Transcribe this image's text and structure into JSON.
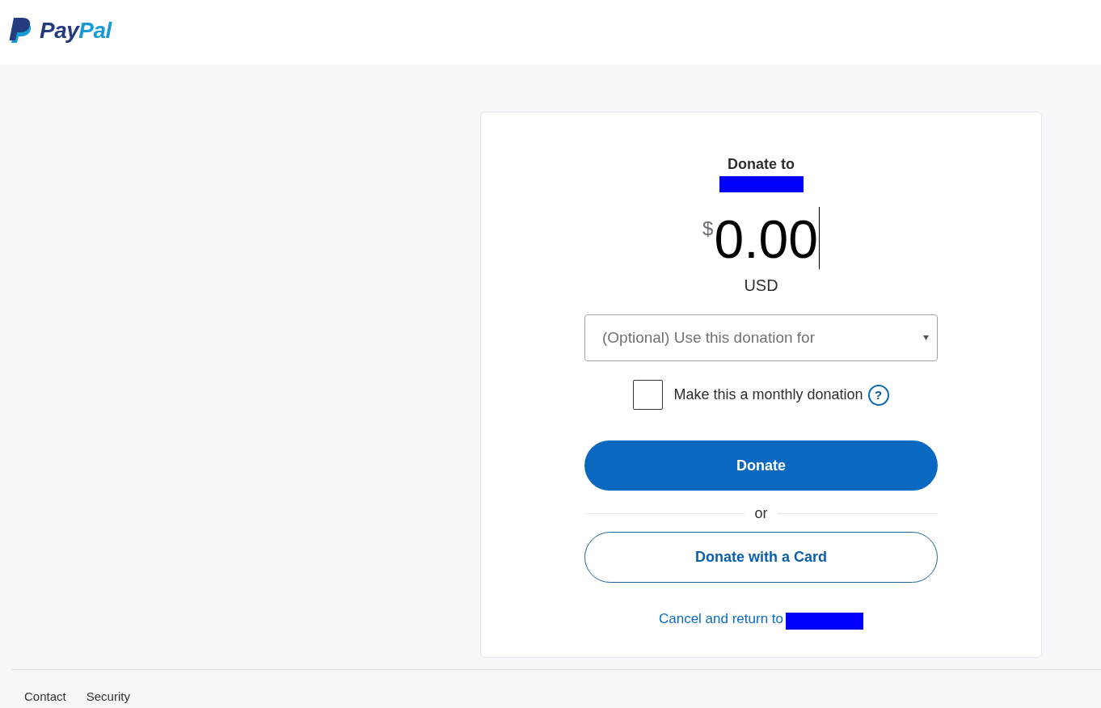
{
  "header": {
    "logo": {
      "wordmark": [
        "Pay",
        "Pal"
      ]
    }
  },
  "donation_form": {
    "heading": "Donate to",
    "amount": {
      "currency_symbol": "$",
      "value": "0.00",
      "currency": "USD",
      "focused": true
    },
    "purpose_dropdown": {
      "placeholder": "(Optional) Use this donation for"
    },
    "monthly": {
      "label": "Make this a monthly donation",
      "checked": false,
      "help": "?"
    },
    "donate_button": "Donate",
    "divider": "or",
    "card_button": "Donate with a Card",
    "cancel_link": "Cancel and return to"
  },
  "footer": {
    "links": [
      "Contact",
      "Security"
    ]
  }
}
